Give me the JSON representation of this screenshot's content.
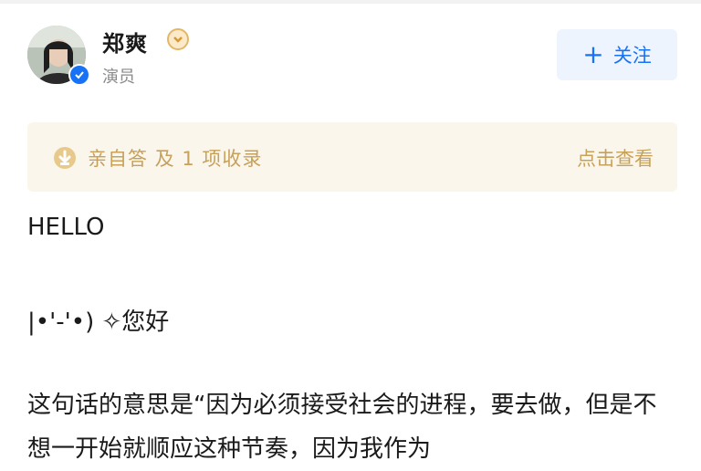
{
  "author": {
    "name": "郑爽",
    "title": "演员",
    "verified": true
  },
  "follow_button": {
    "icon": "plus-icon",
    "label": "关注"
  },
  "answer_banner": {
    "text": "亲自答 及 1 项收录",
    "link": "点击查看"
  },
  "content": {
    "paragraphs": [
      "HELLO",
      "|•'-'•) ✧您好",
      "这句话的意思是“因为必须接受社会的进程，要去做，但是不想一开始就顺应这种节奏，因为我作为"
    ]
  },
  "colors": {
    "accent": "#1772f6",
    "banner_bg": "#fbf6ec",
    "banner_text": "#c7a15a"
  }
}
